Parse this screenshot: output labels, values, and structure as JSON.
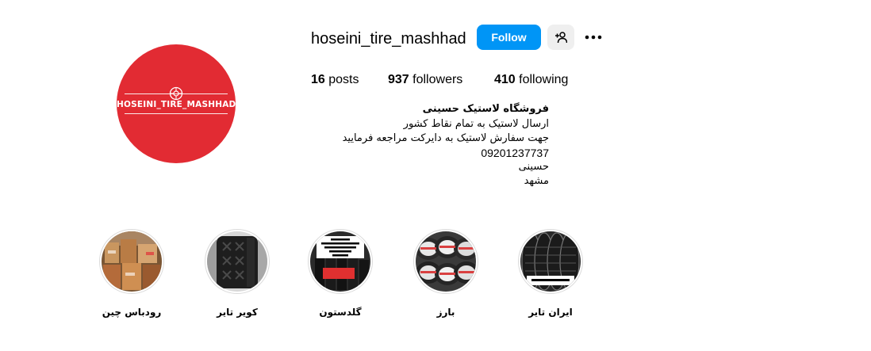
{
  "profile": {
    "username": "hoseini_tire_mashhad",
    "avatar_logo_text": "HOSEINI_TIRE_MASHHAD",
    "follow_label": "Follow",
    "posts_count": "16",
    "posts_label": "posts",
    "followers_count": "937",
    "followers_label": "followers",
    "following_count": "410",
    "following_label": "following"
  },
  "icons": {
    "suggest": "person-add-icon",
    "more": "more-options-icon"
  },
  "bio": {
    "name": "فروشگاه لاستیک حسینی",
    "lines": [
      "ارسال لاستیک به تمام نقاط کشور",
      "جهت سفارش لاستیک به دایرکت مراجعه فرمایید",
      "09201237737",
      "حسینی",
      "مشهد"
    ]
  },
  "highlights": [
    {
      "label": "رودباس چین"
    },
    {
      "label": "کویر تایر"
    },
    {
      "label": "گلدستون",
      "overlay": "گلدستون\nسایز۱۷-۲۶۵/۶۵\nتعداد بالا موجود\nقیمت ۸۰۰"
    },
    {
      "label": "بارز"
    },
    {
      "label": "ایران تایر",
      "overlay": "ایران تایر ۱۴/۱۸۵"
    }
  ],
  "colors": {
    "accent": "#0095f6",
    "avatar_bg": "#e22b33",
    "button_secondary": "#efefef",
    "ring": "#dbdbdb"
  }
}
